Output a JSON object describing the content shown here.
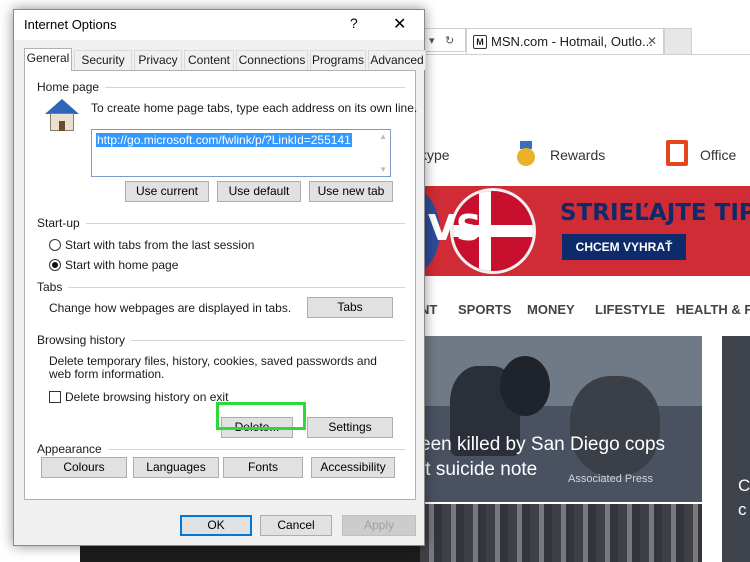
{
  "browser": {
    "tab_title": "MSN.com - Hotmail, Outlo...",
    "tab_close": "✕",
    "favicon": "msn-icon",
    "header_links": [
      "kype",
      "Rewards",
      "Office"
    ],
    "banner": {
      "vs": "VS",
      "headline": "STRIEĽAJTE TIPY A",
      "cta": "CHCEM VYHRAŤ"
    },
    "nav": [
      "NT",
      "SPORTS",
      "MONEY",
      "LIFESTYLE",
      "HEALTH & F"
    ],
    "story": {
      "line1": "een killed by San Diego cops",
      "line2": "ft suicide note",
      "source": "Associated Press"
    },
    "side_letter_1": "C",
    "side_letter_2": "c"
  },
  "dialog": {
    "title": "Internet Options",
    "help": "?",
    "close": "✕",
    "tabs": [
      "General",
      "Security",
      "Privacy",
      "Content",
      "Connections",
      "Programs",
      "Advanced"
    ],
    "home_page": {
      "label": "Home page",
      "description": "To create home page tabs, type each address on its own line.",
      "url": "http://go.microsoft.com/fwlink/p/?LinkId=255141",
      "buttons": [
        "Use current",
        "Use default",
        "Use new tab"
      ]
    },
    "startup": {
      "label": "Start-up",
      "options": [
        "Start with tabs from the last session",
        "Start with home page"
      ],
      "selected": 1
    },
    "tabs_section": {
      "label": "Tabs",
      "description": "Change how webpages are displayed in tabs.",
      "button": "Tabs"
    },
    "browsing_history": {
      "label": "Browsing history",
      "description": "Delete temporary files, history, cookies, saved passwords and web form information.",
      "checkbox_label": "Delete browsing history on exit",
      "delete_button": "Delete...",
      "settings_button": "Settings"
    },
    "appearance": {
      "label": "Appearance",
      "buttons": [
        "Colours",
        "Languages",
        "Fonts",
        "Accessibility"
      ]
    },
    "footer": {
      "ok": "OK",
      "cancel": "Cancel",
      "apply": "Apply"
    }
  },
  "colors": {
    "highlight": "#2ed83a",
    "selection": "#3399ff",
    "banner_red": "#cf2c36",
    "banner_navy": "#0d2a6b"
  }
}
